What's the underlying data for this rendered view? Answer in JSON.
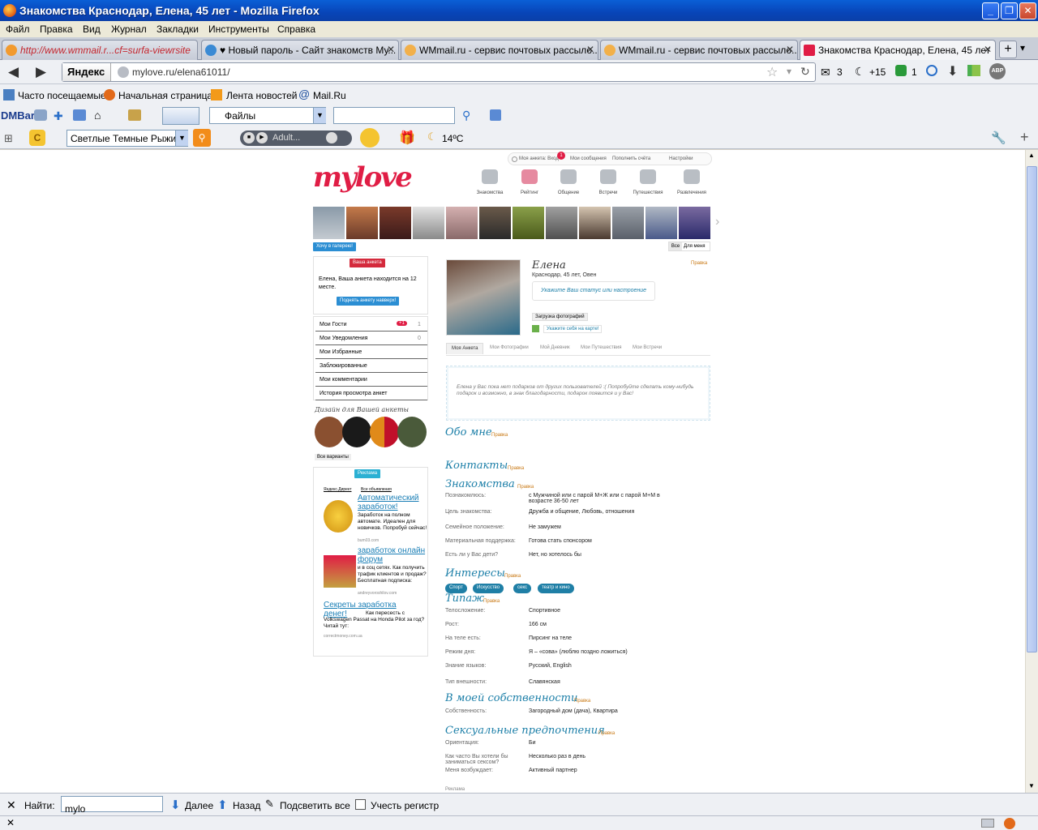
{
  "window": {
    "title": "Знакомства Краснодар, Елена, 45 лет - Mozilla Firefox"
  },
  "menu": [
    "Файл",
    "Правка",
    "Вид",
    "Журнал",
    "Закладки",
    "Инструменты",
    "Справка"
  ],
  "tabs": [
    {
      "label": "http://www.wmmail.r...cf=surfa-viewrsite"
    },
    {
      "label": "♥ Новый пароль - Сайт знакомств Му..."
    },
    {
      "label": "WMmail.ru - сервис почтовых рассыло..."
    },
    {
      "label": "WMmail.ru - сервис почтовых рассыло..."
    },
    {
      "label": "Знакомства Краснодар, Елена, 45 лет"
    }
  ],
  "nav": {
    "yandex_label": "Яндекс",
    "url": "mylove.ru/elena61011/",
    "mail_count": "3",
    "plus_count": "+15",
    "green_count": "1",
    "abp": "ABP"
  },
  "bookmarks": [
    "Часто посещаемые",
    "Начальная страница",
    "Лента новостей",
    "Mail.Ru"
  ],
  "dmbar": {
    "label": "DMBar",
    "files": "Файлы"
  },
  "ybar": {
    "select": "Светлые Темные Рыжие",
    "player": "Adult...",
    "weather": "14ºC"
  },
  "findbar": {
    "label": "Найти:",
    "value": "mylo",
    "next": "Далее",
    "prev": "Назад",
    "highlight": "Подсветить все",
    "matchcase": "Учесть регистр"
  },
  "page": {
    "logo": "mylove",
    "toplinks": [
      "Моя анкета: Вход",
      "Мои сообщения",
      "Пополнить счёта",
      "Настройки"
    ],
    "toplinks_badge": "1",
    "navlinks": [
      "Знакомства",
      "Рейтинг",
      "Общение",
      "Встречи",
      "Путешествия",
      "Развлечения"
    ],
    "gallery_button": "Хочу в галерею!",
    "toggle_all": "Все",
    "toggle_me": "Для меня",
    "your_profile": "Ваша анкета",
    "profile_msg": "Елена, Ваша анкета находится на 12 месте.",
    "raise_btn": "Поднять анкету навверх!",
    "left_menu": [
      {
        "label": "Мои Гости",
        "badge": "+1",
        "count": "1"
      },
      {
        "label": "Мои Уведомления",
        "badge": "",
        "count": "0"
      },
      {
        "label": "Мои Избранные",
        "badge": "",
        "count": ""
      },
      {
        "label": "Заблокированные",
        "badge": "",
        "count": ""
      },
      {
        "label": "Мои комментарии",
        "badge": "",
        "count": ""
      },
      {
        "label": "История просмотра анкет",
        "badge": "",
        "count": ""
      }
    ],
    "design_title": "Дизайн для Вашей анкеты",
    "all_variants": "Все варианты",
    "ad_label": "Реклама",
    "ad_direct": "Яндекс.Директ",
    "ad_all": "Все объявления",
    "ads": [
      {
        "title": "Автоматический заработок!",
        "text": "Заработок на полном автомате. Идеален для новичков. Попробуй сейчас!",
        "domain": "bum03.com"
      },
      {
        "title": "заработок онлайн форум",
        "text": "и в соц сетях. Как получить трафик клиентов и продаж? Бесплатная подписка:",
        "domain": "andreyvoroshilov.com"
      },
      {
        "title": "Секреты заработка денег!",
        "text": "Как пересесть с Volkswagen Passat на Honda Pilot за год? Читай тут:",
        "domain": "correctmoney.com.ua"
      }
    ],
    "name": "Елена",
    "edit": "Правка",
    "location": "Краснодар, 45 лет, Овен",
    "status_prompt": "Укажите Ваш статус или настроение",
    "upload_photo": "Загрузка фотографий",
    "map_link": "Укажите себя на карте!",
    "profile_tabs": [
      "Моя Анкета",
      "Мои Фотографии",
      "Мой Дневник",
      "Мои Путешествия",
      "Мои Встречи"
    ],
    "gifts_text": "Елена у Вас пока нет подарков от других пользователей :( Попробуйте сделать кому-нибудь подарок и возможно, в знак благодарности, подарок появится и у Вас!",
    "sections": {
      "about": "Обо мне",
      "contacts": "Контакты",
      "dating": "Знакомства",
      "interests": "Интересы",
      "type": "Типаж",
      "property": "В моей собственности",
      "sexual": "Сексуальные предпочтения"
    },
    "dating_rows": [
      {
        "label": "Познакомлюсь:",
        "value": "с Мужчиной или с парой М+Ж или с парой М+М в возрасте 36-50 лет"
      },
      {
        "label": "Цель знакомства:",
        "value": "Дружба и общение, Любовь, отношения"
      },
      {
        "label": "Семейное положение:",
        "value": "Не замужем"
      },
      {
        "label": "Материальная поддержка:",
        "value": "Готова стать спонсором"
      },
      {
        "label": "Есть ли у Вас дети?",
        "value": "Нет, но хотелось бы"
      }
    ],
    "interests_tags": [
      "Спорт",
      "Искусство",
      "секс",
      "театр и кино"
    ],
    "type_rows": [
      {
        "label": "Телосложение:",
        "value": "Спортивное"
      },
      {
        "label": "Рост:",
        "value": "166 см"
      },
      {
        "label": "На теле есть:",
        "value": "Пирсинг на теле"
      },
      {
        "label": "Режим дня:",
        "value": "Я – «сова» (люблю поздно ложиться)"
      },
      {
        "label": "Знание языков:",
        "value": "Русский, English"
      },
      {
        "label": "Тип внешности:",
        "value": "Славянская"
      }
    ],
    "property_rows": [
      {
        "label": "Собственность:",
        "value": "Загородный дом (дача), Квартира"
      }
    ],
    "sexual_rows": [
      {
        "label": "Ориентация:",
        "value": "Би"
      },
      {
        "label": "Как часто Вы хотели бы заниматься сексом?",
        "value": "Несколько раз в день"
      },
      {
        "label": "Меня возбуждает:",
        "value": "Активный партнер"
      }
    ],
    "bottom_ad": "Реклама"
  },
  "colors": {
    "accent": "#e01d45",
    "link": "#1c7fa8",
    "pill": "#2b8ed3"
  }
}
